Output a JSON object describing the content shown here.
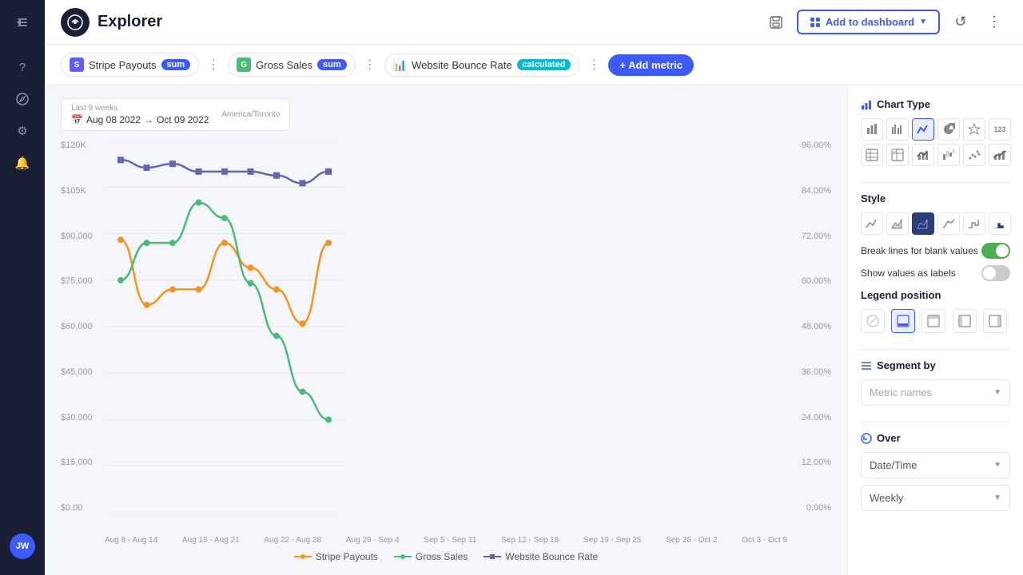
{
  "app": {
    "title": "Explorer",
    "logo_char": "⊙"
  },
  "topbar": {
    "save_icon": "💾",
    "add_dashboard_label": "Add to dashboard",
    "refresh_icon": "↺",
    "more_icon": "⋮"
  },
  "metrics": [
    {
      "id": "stripe",
      "icon": "S",
      "icon_bg": "#635bff",
      "label": "Stripe Payouts",
      "badge": "sum",
      "badge_type": "sum"
    },
    {
      "id": "gross",
      "icon": "G",
      "icon_bg": "#48bb78",
      "label": "Gross Sales",
      "badge": "sum",
      "badge_type": "sum"
    },
    {
      "id": "bounce",
      "icon": "📊",
      "icon_bg": "#f6ad55",
      "label": "Website Bounce Rate",
      "badge": "calculated",
      "badge_type": "calculated"
    }
  ],
  "add_metric_label": "+ Add metric",
  "date_range": {
    "label": "Last 9 weeks",
    "timezone": "America/Toronto",
    "start": "Aug 08 2022",
    "arrow": "→",
    "end": "Oct 09 2022"
  },
  "chart": {
    "y_left_labels": [
      "$120K",
      "$105K",
      "$90,000",
      "$75,000",
      "$60,000",
      "$45,000",
      "$30,000",
      "$15,000",
      "$0.00"
    ],
    "y_right_labels": [
      "96.00%",
      "84.00%",
      "72.00%",
      "60.00%",
      "48.00%",
      "36.00%",
      "24.00%",
      "12.00%",
      "0.00%"
    ],
    "x_labels": [
      "Aug 8 - Aug 14",
      "Aug 15 - Aug 21",
      "Aug 22 - Aug 28",
      "Aug 29 - Sep 4",
      "Sep 5 - Sep 11",
      "Sep 12 - Sep 18",
      "Sep 19 - Sep 25",
      "Sep 26 - Oct 2",
      "Oct 3 - Oct 9"
    ],
    "series": [
      {
        "name": "Stripe Payouts",
        "color": "#f6921e",
        "points": [
          87,
          68,
          73,
          72,
          87,
          79,
          72,
          60,
          88
        ]
      },
      {
        "name": "Gross Sales",
        "color": "#48bb78",
        "points": [
          76,
          88,
          86,
          100,
          95,
          75,
          58,
          40,
          30
        ]
      },
      {
        "name": "Website Bounce Rate",
        "color": "#6366b1",
        "points": [
          94,
          89,
          90,
          88,
          88,
          88,
          87,
          84,
          88
        ]
      }
    ]
  },
  "right_panel": {
    "chart_type_title": "Chart Type",
    "chart_types": [
      {
        "id": "bar",
        "icon": "▬",
        "active": false
      },
      {
        "id": "grouped-bar",
        "icon": "▮▮",
        "active": false
      },
      {
        "id": "line",
        "icon": "╱",
        "active": true
      },
      {
        "id": "pie",
        "icon": "◔",
        "active": false
      },
      {
        "id": "star",
        "icon": "✦",
        "active": false
      },
      {
        "id": "num",
        "icon": "123",
        "active": false
      },
      {
        "id": "table",
        "icon": "⊞",
        "active": false
      },
      {
        "id": "pivot",
        "icon": "⊟",
        "active": false
      },
      {
        "id": "bar-line",
        "icon": "⟁",
        "active": false
      },
      {
        "id": "waterfall",
        "icon": "≣",
        "active": false
      },
      {
        "id": "scatter",
        "icon": "∷",
        "active": false
      },
      {
        "id": "combo",
        "icon": "⊿",
        "active": false
      }
    ],
    "style_title": "Style",
    "styles": [
      {
        "id": "line-plain",
        "active": false
      },
      {
        "id": "area-fill",
        "active": false
      },
      {
        "id": "area-dark",
        "active": true
      },
      {
        "id": "smooth-line",
        "active": false
      },
      {
        "id": "step-chart",
        "active": false
      },
      {
        "id": "step-dark",
        "active": false
      }
    ],
    "break_lines_label": "Break lines for blank values",
    "break_lines_on": true,
    "show_values_label": "Show values as labels",
    "show_values_on": false,
    "legend_position_title": "Legend position",
    "legend_positions": [
      {
        "id": "none",
        "icon": "⊘",
        "active": false
      },
      {
        "id": "bottom",
        "icon": "▣",
        "active": true
      },
      {
        "id": "top",
        "icon": "▢",
        "active": false
      },
      {
        "id": "left",
        "icon": "▣",
        "active": false
      },
      {
        "id": "right",
        "icon": "▣",
        "active": false
      }
    ],
    "segment_by_title": "Segment by",
    "segment_placeholder": "Metric names",
    "over_title": "Over",
    "over_placeholder": "Date/Time",
    "frequency_placeholder": "Weekly"
  },
  "sidebar": {
    "items": [
      {
        "id": "nav",
        "icon": "→",
        "label": "Navigate"
      },
      {
        "id": "question",
        "icon": "?",
        "label": "Help"
      },
      {
        "id": "explore",
        "icon": "◎",
        "label": "Explore"
      },
      {
        "id": "settings",
        "icon": "⚙",
        "label": "Settings"
      },
      {
        "id": "alerts",
        "icon": "🔔",
        "label": "Alerts"
      }
    ],
    "user_initials": "JW"
  }
}
